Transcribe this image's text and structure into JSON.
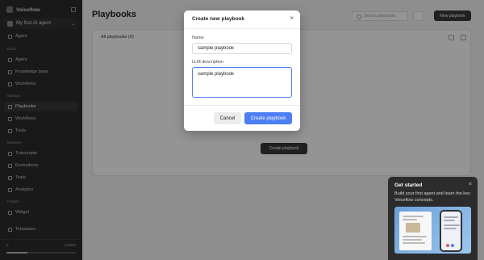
{
  "sidebar": {
    "brand": "Voiceflow",
    "project": "My first AI agent",
    "sections": [
      "Build",
      "Manage",
      "Measure",
      "Publish"
    ],
    "items": [
      "Agent",
      "Knowledge base",
      "Workflows",
      "Playbooks",
      "Workflows",
      "Tools",
      "Transcripts",
      "Evaluations",
      "Tests",
      "Analytics",
      "Widget",
      "Templates"
    ],
    "footer_left": "0",
    "footer_right": "Credits"
  },
  "page": {
    "title": "Playbooks",
    "search_placeholder": "Search playbooks",
    "new_button": "New playbook",
    "count": "All playbooks (0)",
    "empty_button": "Create playbook"
  },
  "modal": {
    "title": "Create new playbook",
    "name_label": "Name",
    "name_value": "sample playbook",
    "description_label": "LLM description",
    "description_value": "sample playbook",
    "cancel_label": "Cancel",
    "create_label": "Create playbook",
    "close_icon": "×"
  },
  "get_started": {
    "title": "Get started",
    "text": "Build your first agent and learn the key Voiceflow concepts.",
    "close_icon": "×"
  },
  "colors": {
    "accent": "#4d7ef3",
    "overlay": "rgba(0,0,0,0.42)",
    "card_bg": "#2c2c2c"
  }
}
